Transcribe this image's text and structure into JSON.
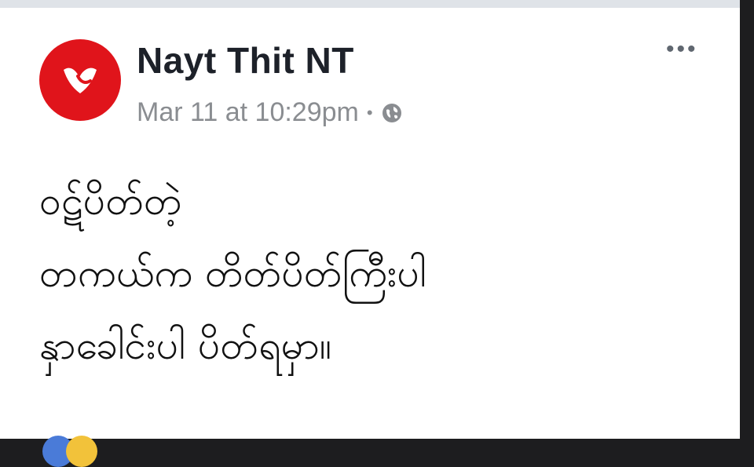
{
  "post": {
    "author": "Nayt Thit NT",
    "timestamp": "Mar 11 at 10:29pm",
    "separator": "•",
    "privacy_icon": "globe-icon",
    "more_label": "•••",
    "lines": [
      "ဝဋ်ပိတ်တဲ့",
      "တကယ်က တိတ်ပိတ်ကြီးပါ",
      "နှာခေါင်းပါ ပိတ်ရမှာ။"
    ]
  },
  "colors": {
    "avatar": "#e0141b",
    "author": "#1d2129",
    "meta": "#8a8d91"
  }
}
